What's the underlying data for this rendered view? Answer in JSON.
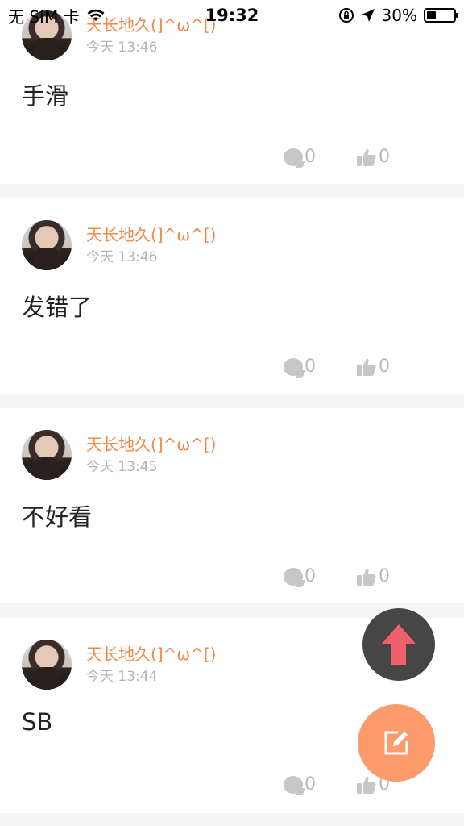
{
  "status_bar": {
    "carrier": "无 SIM 卡",
    "time": "19:32",
    "battery_percent": "30%",
    "battery_level": 0.3
  },
  "posts": [
    {
      "username": "天长地久(]^ω^[)",
      "time": "今天 13:46",
      "content": "手滑",
      "comments": "0",
      "likes": "0"
    },
    {
      "username": "天长地久(]^ω^[)",
      "time": "今天 13:46",
      "content": "发错了",
      "comments": "0",
      "likes": "0"
    },
    {
      "username": "天长地久(]^ω^[)",
      "time": "今天 13:45",
      "content": "不好看",
      "comments": "0",
      "likes": "0"
    },
    {
      "username": "天长地久(]^ω^[)",
      "time": "今天 13:44",
      "content": "SB",
      "comments": "0",
      "likes": "0"
    }
  ],
  "icons": {
    "scroll_top": "arrow-up-icon",
    "compose": "edit-icon",
    "comment": "comment-icon",
    "like": "thumbs-up-icon"
  },
  "colors": {
    "username": "#f08a4b",
    "compose_fab": "#fc9b6c",
    "scroll_top_fab": "#464646",
    "arrow": "#f0606a"
  }
}
